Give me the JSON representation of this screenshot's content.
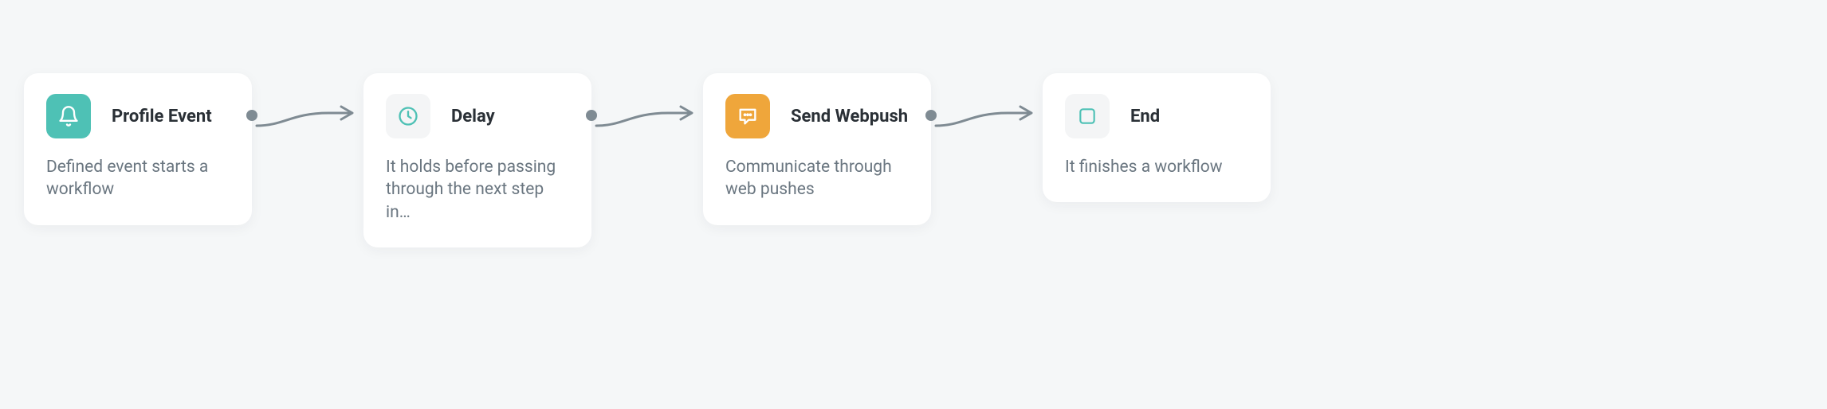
{
  "nodes": [
    {
      "id": "profile-event",
      "icon": "bell-icon",
      "icon_style": "teal",
      "title": "Profile Event",
      "description": "Defined event starts a workflow",
      "has_outgoing": true
    },
    {
      "id": "delay",
      "icon": "clock-icon",
      "icon_style": "gray",
      "title": "Delay",
      "description": "It holds before passing through the next step in…",
      "has_outgoing": true
    },
    {
      "id": "send-webpush",
      "icon": "chat-icon",
      "icon_style": "orange",
      "title": "Send Webpush",
      "description": "Communicate through web pushes",
      "has_outgoing": true
    },
    {
      "id": "end",
      "icon": "square-icon",
      "icon_style": "gray",
      "title": "End",
      "description": "It finishes a workflow",
      "has_outgoing": false
    }
  ],
  "colors": {
    "teal": "#4ec1b5",
    "orange": "#efa63b",
    "gray_bg": "#f4f5f6",
    "text_primary": "#2a3036",
    "text_secondary": "#6a7680",
    "connector": "#7f8b93"
  }
}
